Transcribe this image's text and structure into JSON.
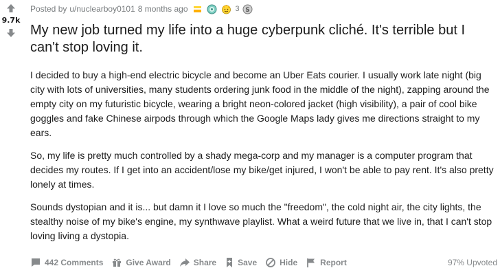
{
  "post": {
    "score": "9.7k",
    "posted_by_prefix": "Posted by",
    "username": "u/nuclearboy0101",
    "time_ago": "8 months ago",
    "award_count": "3",
    "title": "My new job turned my life into a huge cyberpunk cliché. It's terrible but I can't stop loving it.",
    "paragraphs": [
      "I decided to buy a high-end electric bicycle and become an Uber Eats courier. I usually work late night (big city with lots of universities, many students ordering junk food in the middle of the night), zapping around the empty city on my futuristic bicycle, wearing a bright neon-colored jacket (high visibility), a pair of cool bike goggles and fake Chinese airpods through which the Google Maps lady gives me directions straight to my ears.",
      "So, my life is pretty much controlled by a shady mega-corp and my manager is a computer program that decides my routes. If I get into an accident/lose my bike/get injured, I won't be able to pay rent. It's also pretty lonely at times.",
      "Sounds dystopian and it is... but damn it I love so much the \"freedom\", the cold night air, the city lights, the stealthy noise of my bike's engine, my synthwave playlist. What a weird future that we live in, that I can't stop loving living a dystopia."
    ],
    "upvote_ratio": "97% Upvoted"
  },
  "actions": {
    "comments": "442 Comments",
    "give_award": "Give Award",
    "share": "Share",
    "save": "Save",
    "hide": "Hide",
    "report": "Report"
  },
  "icons": {
    "upvote": "upvote-arrow-icon",
    "downvote": "downvote-arrow-icon",
    "comment": "comment-icon",
    "award": "gift-icon",
    "share": "share-arrow-icon",
    "save": "bookmark-icon",
    "hide": "hide-icon",
    "report": "flag-icon",
    "award_1": "gold-bar-award-icon",
    "award_2": "teal-medal-award-icon",
    "award_3": "wholesome-award-icon",
    "award_4": "silver-coin-award-icon"
  },
  "colors": {
    "text": "#1c1c1c",
    "meta": "#787c7e",
    "action": "#878a8c"
  }
}
